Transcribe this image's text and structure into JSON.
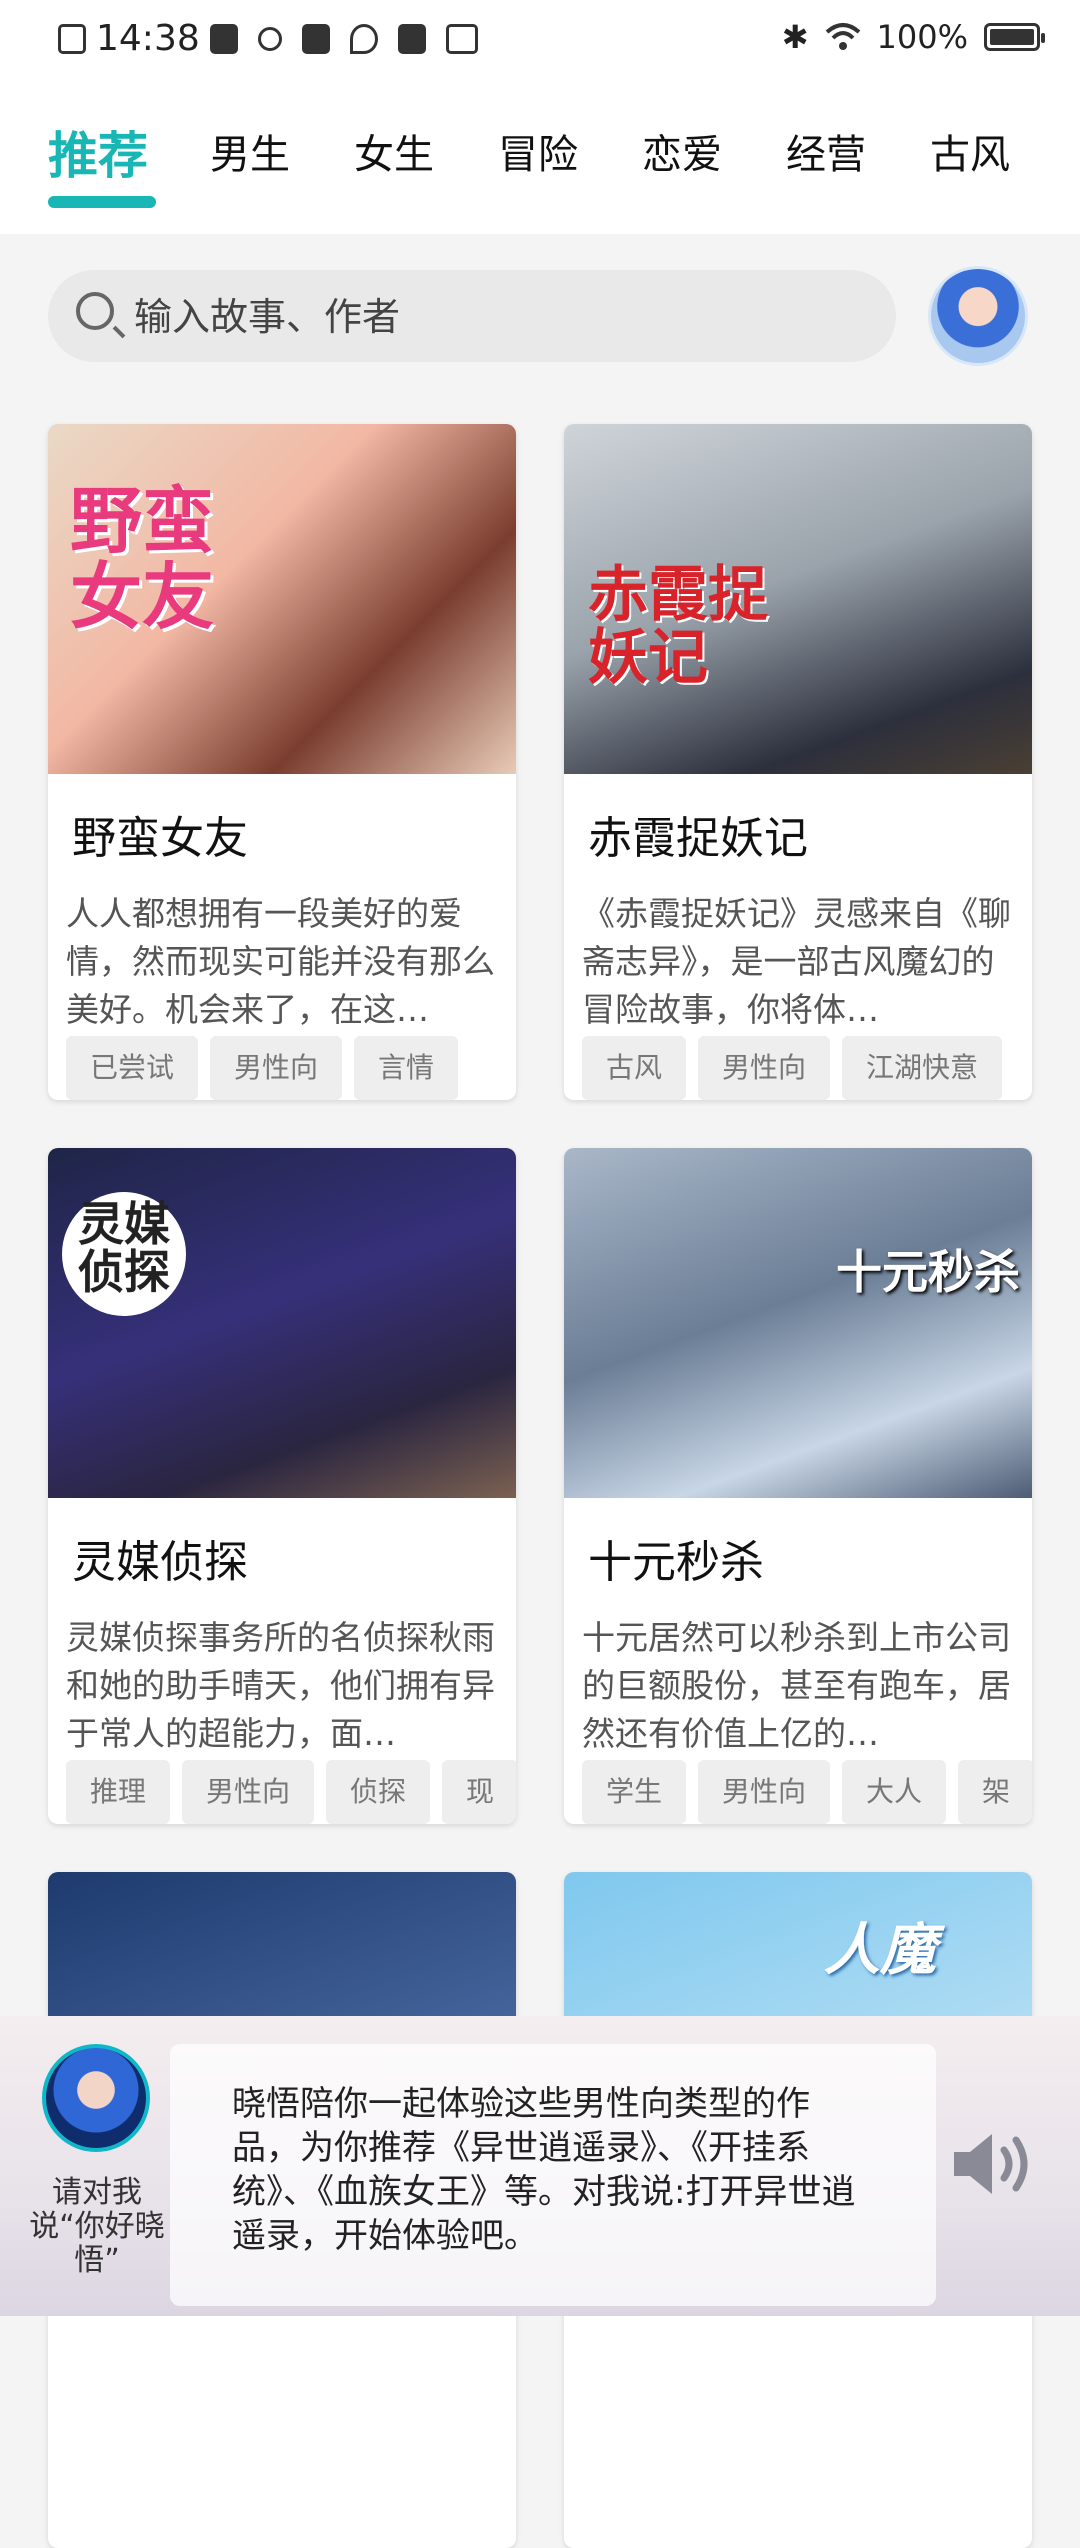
{
  "status_bar": {
    "time": "14:38",
    "battery": "100%",
    "icons": [
      "screenshot-icon",
      "app-icon",
      "usb-icon",
      "clipboard-icon",
      "tiktok-icon",
      "mail-icon",
      "book-icon",
      "bluetooth-icon",
      "wifi-icon",
      "battery-icon"
    ]
  },
  "tabs": [
    {
      "label": "推荐",
      "active": true
    },
    {
      "label": "男生"
    },
    {
      "label": "女生"
    },
    {
      "label": "冒险"
    },
    {
      "label": "恋爱"
    },
    {
      "label": "经营"
    },
    {
      "label": "古风"
    }
  ],
  "search": {
    "placeholder": "输入故事、作者"
  },
  "cards": [
    {
      "title": "野蛮女友",
      "cover_text": "野蛮女友",
      "desc": "人人都想拥有一段美好的爱情，然而现实可能并没有那么美好。机会来了，在这…",
      "tags": [
        "已尝试",
        "男性向",
        "言情",
        ""
      ]
    },
    {
      "title": "赤霞捉妖记",
      "cover_text": "赤霞捉妖记",
      "desc": "《赤霞捉妖记》灵感来自《聊斋志异》，是一部古风魔幻的冒险故事，你将体…",
      "tags": [
        "古风",
        "男性向",
        "江湖快意"
      ]
    },
    {
      "title": "灵媒侦探",
      "cover_text": "灵媒侦探",
      "desc": "灵媒侦探事务所的名侦探秋雨和她的助手晴天，他们拥有异于常人的超能力，面…",
      "tags": [
        "推理",
        "男性向",
        "侦探",
        "现"
      ]
    },
    {
      "title": "十元秒杀",
      "cover_text": "十元秒杀",
      "desc": "十元居然可以秒杀到上市公司的巨额股份，甚至有跑车，居然还有价值上亿的…",
      "tags": [
        "学生",
        "男性向",
        "大人",
        "架"
      ]
    },
    {
      "title": "",
      "cover_text": ""
    },
    {
      "title": "",
      "cover_text": "人魔"
    }
  ],
  "assistant": {
    "message": "晓悟陪你一起体验这些男性向类型的作品，为你推荐《异世逍遥录》、《开挂系统》、《血族女王》等。对我说:打开异世逍遥录，开始体验吧。",
    "hint": "请对我说“你好晓悟”",
    "speaker_icon": "speaker-icon"
  },
  "colors": {
    "accent": "#19b6b6"
  }
}
